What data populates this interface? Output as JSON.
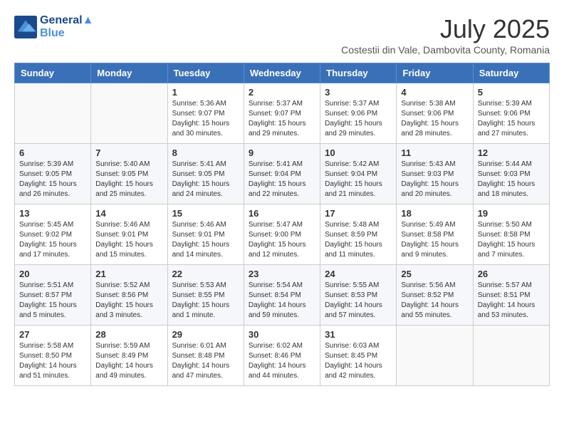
{
  "header": {
    "logo_line1": "General",
    "logo_line2": "Blue",
    "month_year": "July 2025",
    "subtitle": "Costestii din Vale, Dambovita County, Romania"
  },
  "weekdays": [
    "Sunday",
    "Monday",
    "Tuesday",
    "Wednesday",
    "Thursday",
    "Friday",
    "Saturday"
  ],
  "weeks": [
    [
      {
        "day": "",
        "info": ""
      },
      {
        "day": "",
        "info": ""
      },
      {
        "day": "1",
        "info": "Sunrise: 5:36 AM\nSunset: 9:07 PM\nDaylight: 15 hours\nand 30 minutes."
      },
      {
        "day": "2",
        "info": "Sunrise: 5:37 AM\nSunset: 9:07 PM\nDaylight: 15 hours\nand 29 minutes."
      },
      {
        "day": "3",
        "info": "Sunrise: 5:37 AM\nSunset: 9:06 PM\nDaylight: 15 hours\nand 29 minutes."
      },
      {
        "day": "4",
        "info": "Sunrise: 5:38 AM\nSunset: 9:06 PM\nDaylight: 15 hours\nand 28 minutes."
      },
      {
        "day": "5",
        "info": "Sunrise: 5:39 AM\nSunset: 9:06 PM\nDaylight: 15 hours\nand 27 minutes."
      }
    ],
    [
      {
        "day": "6",
        "info": "Sunrise: 5:39 AM\nSunset: 9:05 PM\nDaylight: 15 hours\nand 26 minutes."
      },
      {
        "day": "7",
        "info": "Sunrise: 5:40 AM\nSunset: 9:05 PM\nDaylight: 15 hours\nand 25 minutes."
      },
      {
        "day": "8",
        "info": "Sunrise: 5:41 AM\nSunset: 9:05 PM\nDaylight: 15 hours\nand 24 minutes."
      },
      {
        "day": "9",
        "info": "Sunrise: 5:41 AM\nSunset: 9:04 PM\nDaylight: 15 hours\nand 22 minutes."
      },
      {
        "day": "10",
        "info": "Sunrise: 5:42 AM\nSunset: 9:04 PM\nDaylight: 15 hours\nand 21 minutes."
      },
      {
        "day": "11",
        "info": "Sunrise: 5:43 AM\nSunset: 9:03 PM\nDaylight: 15 hours\nand 20 minutes."
      },
      {
        "day": "12",
        "info": "Sunrise: 5:44 AM\nSunset: 9:03 PM\nDaylight: 15 hours\nand 18 minutes."
      }
    ],
    [
      {
        "day": "13",
        "info": "Sunrise: 5:45 AM\nSunset: 9:02 PM\nDaylight: 15 hours\nand 17 minutes."
      },
      {
        "day": "14",
        "info": "Sunrise: 5:46 AM\nSunset: 9:01 PM\nDaylight: 15 hours\nand 15 minutes."
      },
      {
        "day": "15",
        "info": "Sunrise: 5:46 AM\nSunset: 9:01 PM\nDaylight: 15 hours\nand 14 minutes."
      },
      {
        "day": "16",
        "info": "Sunrise: 5:47 AM\nSunset: 9:00 PM\nDaylight: 15 hours\nand 12 minutes."
      },
      {
        "day": "17",
        "info": "Sunrise: 5:48 AM\nSunset: 8:59 PM\nDaylight: 15 hours\nand 11 minutes."
      },
      {
        "day": "18",
        "info": "Sunrise: 5:49 AM\nSunset: 8:58 PM\nDaylight: 15 hours\nand 9 minutes."
      },
      {
        "day": "19",
        "info": "Sunrise: 5:50 AM\nSunset: 8:58 PM\nDaylight: 15 hours\nand 7 minutes."
      }
    ],
    [
      {
        "day": "20",
        "info": "Sunrise: 5:51 AM\nSunset: 8:57 PM\nDaylight: 15 hours\nand 5 minutes."
      },
      {
        "day": "21",
        "info": "Sunrise: 5:52 AM\nSunset: 8:56 PM\nDaylight: 15 hours\nand 3 minutes."
      },
      {
        "day": "22",
        "info": "Sunrise: 5:53 AM\nSunset: 8:55 PM\nDaylight: 15 hours\nand 1 minute."
      },
      {
        "day": "23",
        "info": "Sunrise: 5:54 AM\nSunset: 8:54 PM\nDaylight: 14 hours\nand 59 minutes."
      },
      {
        "day": "24",
        "info": "Sunrise: 5:55 AM\nSunset: 8:53 PM\nDaylight: 14 hours\nand 57 minutes."
      },
      {
        "day": "25",
        "info": "Sunrise: 5:56 AM\nSunset: 8:52 PM\nDaylight: 14 hours\nand 55 minutes."
      },
      {
        "day": "26",
        "info": "Sunrise: 5:57 AM\nSunset: 8:51 PM\nDaylight: 14 hours\nand 53 minutes."
      }
    ],
    [
      {
        "day": "27",
        "info": "Sunrise: 5:58 AM\nSunset: 8:50 PM\nDaylight: 14 hours\nand 51 minutes."
      },
      {
        "day": "28",
        "info": "Sunrise: 5:59 AM\nSunset: 8:49 PM\nDaylight: 14 hours\nand 49 minutes."
      },
      {
        "day": "29",
        "info": "Sunrise: 6:01 AM\nSunset: 8:48 PM\nDaylight: 14 hours\nand 47 minutes."
      },
      {
        "day": "30",
        "info": "Sunrise: 6:02 AM\nSunset: 8:46 PM\nDaylight: 14 hours\nand 44 minutes."
      },
      {
        "day": "31",
        "info": "Sunrise: 6:03 AM\nSunset: 8:45 PM\nDaylight: 14 hours\nand 42 minutes."
      },
      {
        "day": "",
        "info": ""
      },
      {
        "day": "",
        "info": ""
      }
    ]
  ]
}
